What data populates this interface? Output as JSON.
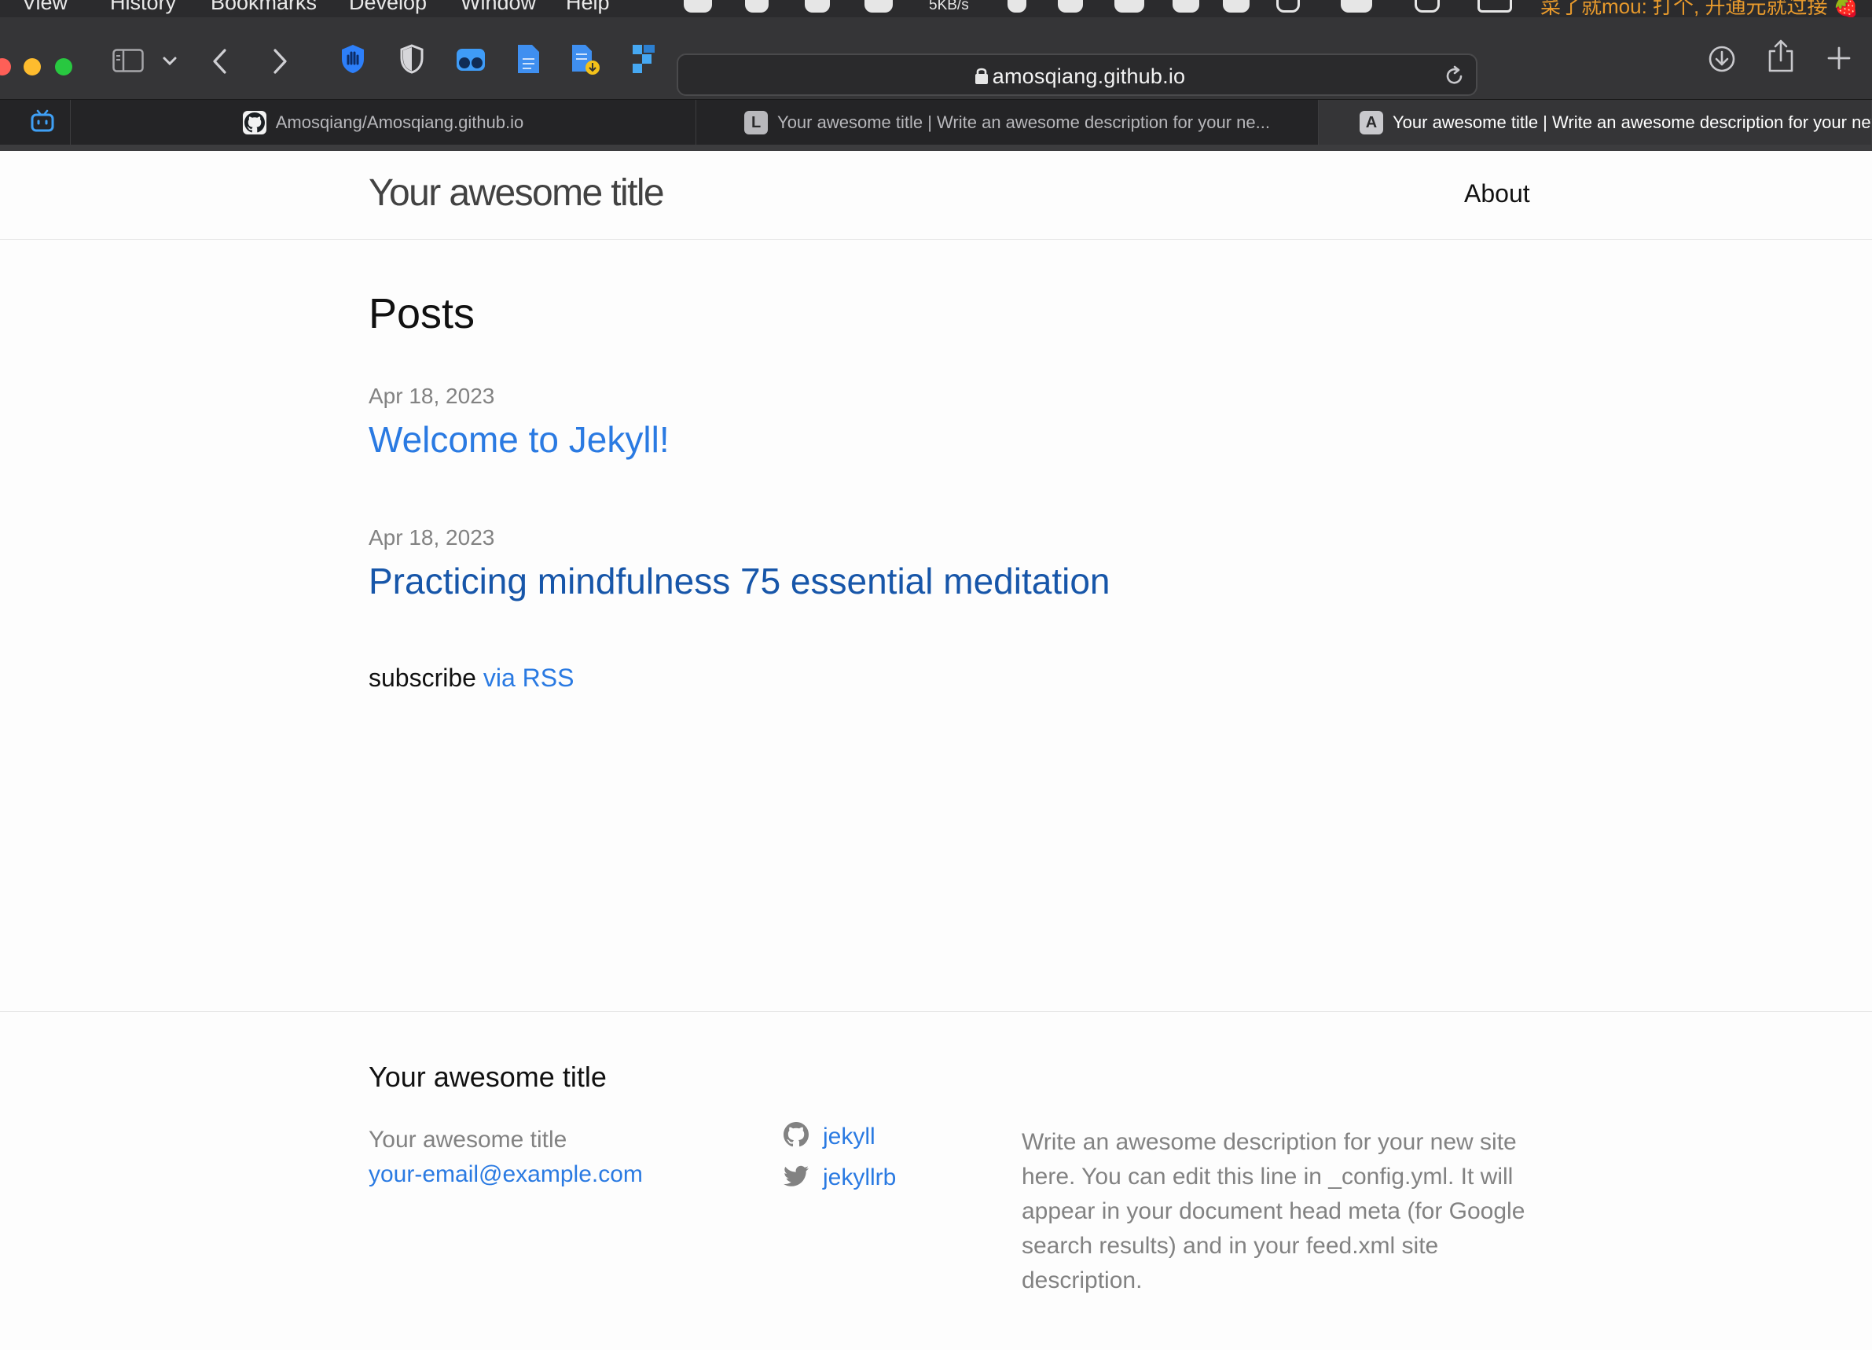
{
  "menubar": {
    "items": [
      "View",
      "History",
      "Bookmarks",
      "Develop",
      "Window",
      "Help"
    ],
    "network_speed": "5KB/s",
    "ticker_text": "菜了就mou: 打个, 开通元就过接 🍓"
  },
  "toolbar": {
    "url": "amosqiang.github.io",
    "icons": [
      "sidebar-icon",
      "chevron-down-icon",
      "back-icon",
      "forward-icon",
      "hand-icon",
      "shield-icon",
      "binoculars-icon",
      "document-icon",
      "download-document-icon",
      "puzzle-icon",
      "lock-icon",
      "reload-icon",
      "download-icon",
      "share-icon",
      "new-tab-icon"
    ]
  },
  "tabs": [
    {
      "favicon": "",
      "title": "Amosqiang/Amosqiang.github.io",
      "active": false
    },
    {
      "favicon": "L",
      "title": "Your awesome title | Write an awesome description for your ne...",
      "active": false
    },
    {
      "favicon": "A",
      "title": "Your awesome title | Write an awesome description for your new site",
      "active": true
    }
  ],
  "header": {
    "site_title": "Your awesome title",
    "nav": [
      "About"
    ]
  },
  "main": {
    "heading": "Posts",
    "posts": [
      {
        "date": "Apr 18, 2023",
        "title": "Welcome to Jekyll!"
      },
      {
        "date": "Apr 18, 2023",
        "title": "Practicing mindfulness 75 essential meditation"
      }
    ],
    "subscribe_text": "subscribe",
    "subscribe_link": "via RSS"
  },
  "footer": {
    "heading": "Your awesome title",
    "name": "Your awesome title",
    "email": "your-email@example.com",
    "social": [
      {
        "icon": "github-icon",
        "label": "jekyll"
      },
      {
        "icon": "twitter-icon",
        "label": "jekyllrb"
      }
    ],
    "description": "Write an awesome description for your new site here. You can edit this line in _config.yml. It will appear in your document head meta (for Google search results) and in your feed.xml site description."
  },
  "colors": {
    "link": "#2a7ae2",
    "visited_link": "#1756a9",
    "muted_text": "#828282",
    "toolbar_bg": "#353537",
    "ticker": "#e89a2c"
  }
}
